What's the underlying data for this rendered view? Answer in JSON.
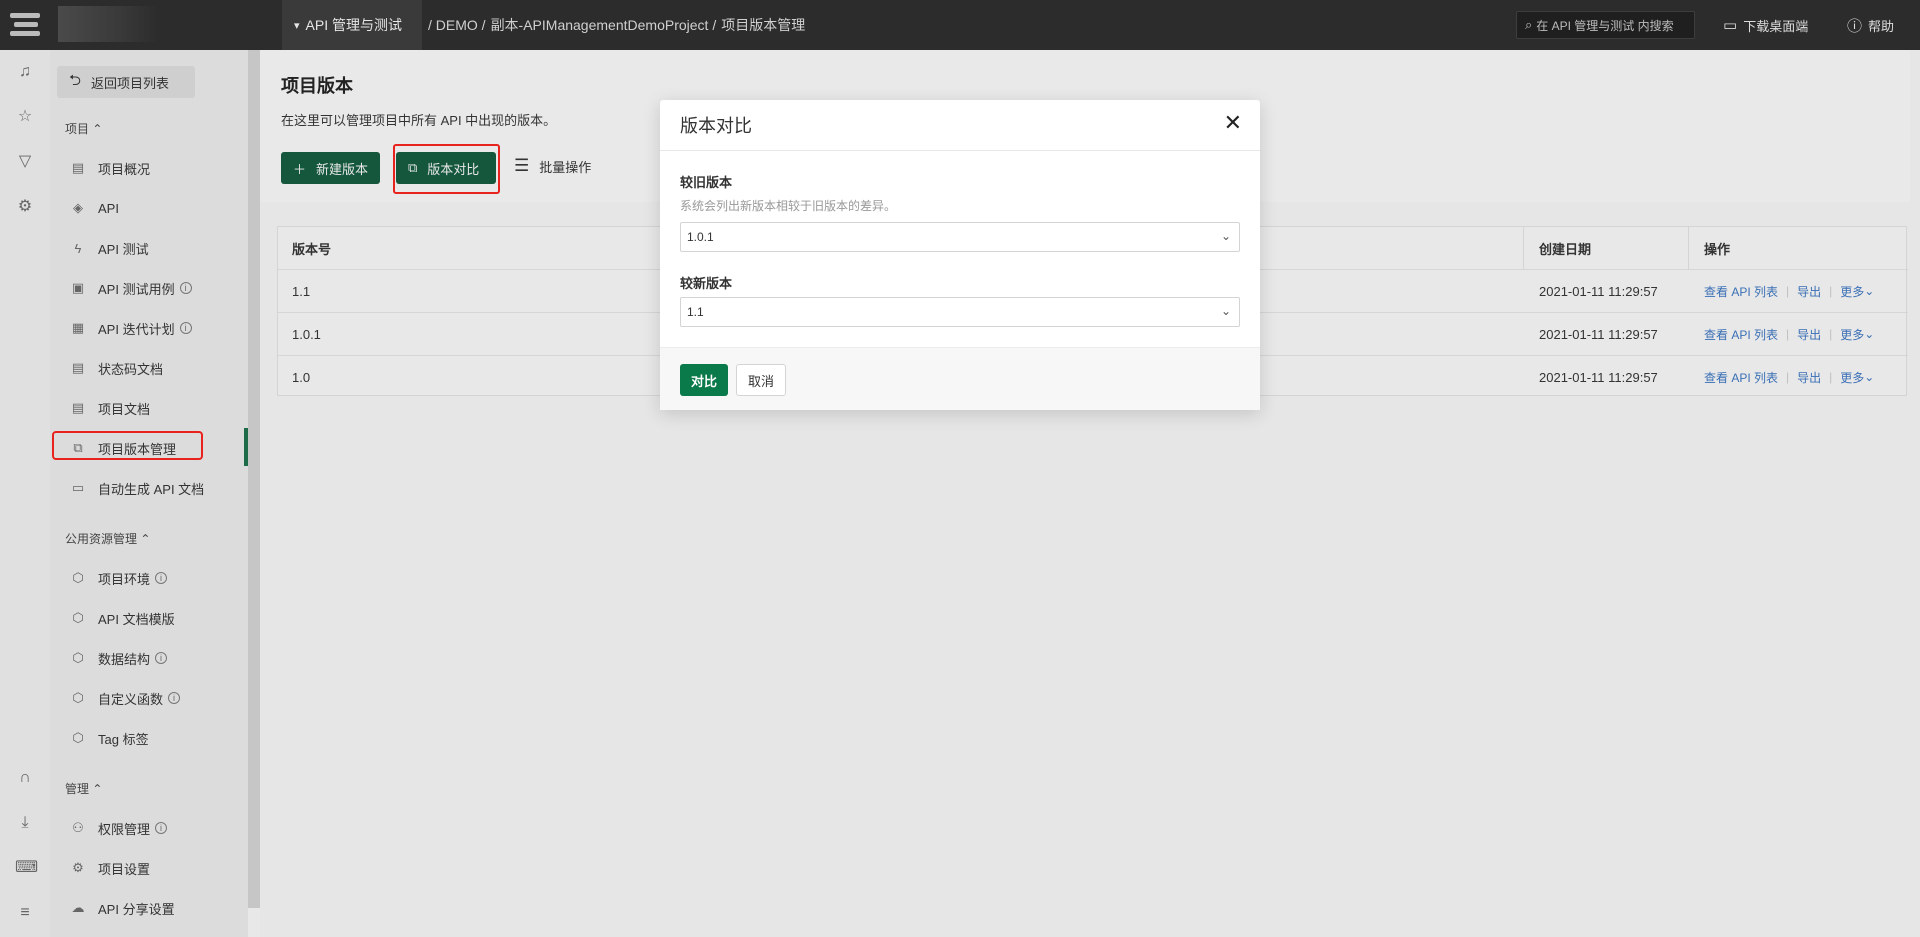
{
  "topbar": {
    "project_menu": "API 管理与测试",
    "breadcrumb": [
      "/ DEMO /",
      "副本-APIManagementDemoProject /",
      "项目版本管理"
    ],
    "search_placeholder": "在 API 管理与测试 内搜索",
    "download": "下载桌面端",
    "help": "帮助"
  },
  "sidebar": {
    "back": "返回项目列表",
    "sections": {
      "project": "项目",
      "public": "公用资源管理",
      "manage": "管理"
    },
    "items": {
      "overview": "项目概况",
      "api": "API",
      "api_test": "API 测试",
      "api_cases": "API 测试用例",
      "api_iteration": "API 迭代计划",
      "status_codes": "状态码文档",
      "docs": "项目文档",
      "versions": "项目版本管理",
      "autogen": "自动生成 API 文档",
      "env": "项目环境",
      "doc_templates": "API 文档模版",
      "data_struct": "数据结构",
      "custom_func": "自定义函数",
      "tags": "Tag 标签",
      "permissions": "权限管理",
      "settings": "项目设置",
      "share": "API 分享设置"
    }
  },
  "page": {
    "title": "项目版本",
    "description": "在这里可以管理项目中所有 API 中出现的版本。",
    "new_version": "新建版本",
    "compare": "版本对比",
    "batch": "批量操作"
  },
  "table": {
    "headers": {
      "version": "版本号",
      "created": "创建日期",
      "actions": "操作"
    },
    "rows": [
      {
        "version": "1.1",
        "created": "2021-01-11 11:29:57"
      },
      {
        "version": "1.0.1",
        "created": "2021-01-11 11:29:57"
      },
      {
        "version": "1.0",
        "created": "2021-01-11 11:29:57"
      }
    ],
    "actions": {
      "view": "查看 API 列表",
      "export": "导出",
      "more": "更多"
    }
  },
  "modal": {
    "title": "版本对比",
    "old_label": "较旧版本",
    "old_hint": "系统会列出新版本相较于旧版本的差异。",
    "old_value": "1.0.1",
    "new_label": "较新版本",
    "new_value": "1.1",
    "confirm": "对比",
    "cancel": "取消"
  },
  "colors": {
    "primary_green": "#14573d",
    "confirm_green": "#0b7a4a",
    "highlight_red": "#e8221c",
    "link_blue": "#3a6fb5"
  }
}
